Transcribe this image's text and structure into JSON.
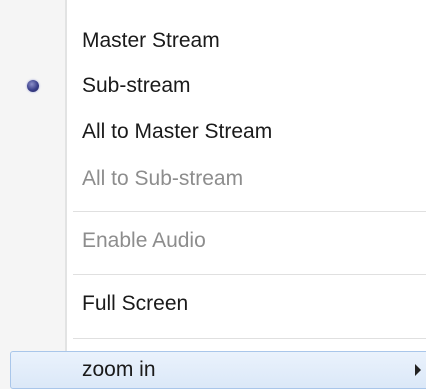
{
  "menu": {
    "items": [
      {
        "label": "Master Stream"
      },
      {
        "label": "Sub-stream"
      },
      {
        "label": "All to Master Stream"
      },
      {
        "label": "All to Sub-stream"
      },
      {
        "label": "Enable Audio"
      },
      {
        "label": "Full Screen"
      },
      {
        "label": "zoom in"
      }
    ]
  },
  "colors": {
    "gutter": "#f5f5f5",
    "text": "#1a1a1a",
    "disabled_text": "#8d8d8d",
    "highlight": "#dbe8f8",
    "highlight_border": "#a9c6ea",
    "radio_bullet": "#3a3f8a"
  },
  "icons": {
    "selected_marker": "radio-bullet-icon",
    "submenu": "submenu-arrow-icon"
  }
}
